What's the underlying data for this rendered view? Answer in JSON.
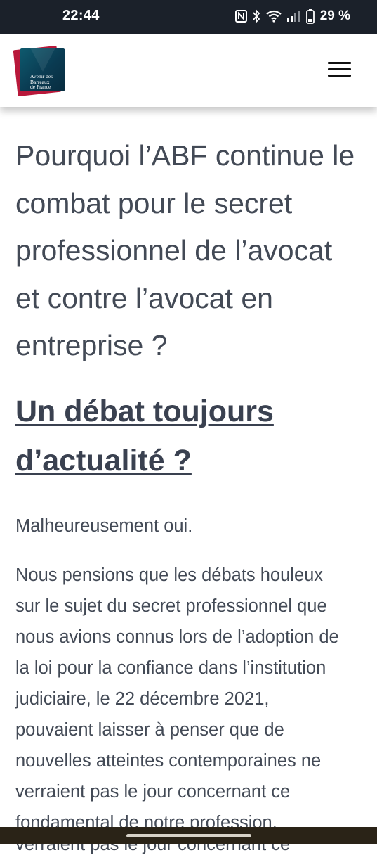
{
  "status_bar": {
    "time": "22:44",
    "battery_text": "29 %",
    "icons": [
      "nfc-icon",
      "bluetooth-icon",
      "wifi-icon",
      "signal-icon",
      "battery-icon"
    ]
  },
  "header": {
    "logo_lines": [
      "Avenir des",
      "Barreaux",
      "de France"
    ],
    "menu_icon": "hamburger-menu-icon"
  },
  "article": {
    "title_lines": [
      "Pourquoi l’ABF continue le",
      "combat pour le secret",
      "professionnel de l’avocat",
      "et contre l’avocat en",
      "entreprise ?"
    ],
    "heading_lines": [
      "Un débat toujours",
      "d’actualité ?"
    ],
    "paragraph_1": "Malheureusement oui.",
    "paragraph_2_lines": [
      "Nous pensions que les débats houleux",
      "sur le sujet du secret professionnel que",
      "nous avions connus lors de l’adoption de",
      "la loi pour la confiance dans l’institution",
      "judiciaire, le 22 décembre 2021,",
      "pouvaient laisser à penser que de",
      "nouvelles atteintes contemporaines ne",
      "verraient pas le jour concernant ce",
      "fondamental de notre profession."
    ],
    "overlap_line": "verraient pas le jour concernant ce"
  },
  "colors": {
    "status_bar_bg": "#1b212a",
    "text": "#434a56",
    "logo_teal": "#0a3b52",
    "logo_red": "#b8183a"
  }
}
